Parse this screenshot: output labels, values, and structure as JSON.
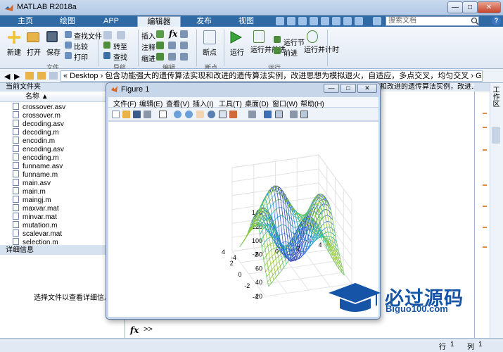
{
  "app": {
    "title": "MATLAB R2018a",
    "min_label": "—",
    "max_label": "□",
    "close_label": "✕"
  },
  "tabs": [
    {
      "label": "主页"
    },
    {
      "label": "绘图"
    },
    {
      "label": "APP"
    },
    {
      "label": "编辑器"
    },
    {
      "label": "发布"
    },
    {
      "label": "视图"
    }
  ],
  "search": {
    "placeholder": "搜索文档",
    "help_label": "?"
  },
  "ribbon": {
    "file": {
      "new": "新建",
      "open": "打开",
      "save": "保存",
      "find_files": "查找文件",
      "compare": "比较",
      "print": "打印",
      "group": "文件"
    },
    "navigate": {
      "goto": "转至",
      "find": "查找",
      "group": "导航"
    },
    "edit": {
      "insert": "插入",
      "comment": "注释",
      "indent": "缩进",
      "fx": "fx",
      "group": "编辑"
    },
    "breakpoints": {
      "label": "断点",
      "group": "断点"
    },
    "run": {
      "run": "运行",
      "run_advance": "运行并前进",
      "run_section": "运行节",
      "advance": "前进",
      "run_time": "运行并计时",
      "group": "运行"
    }
  },
  "address": {
    "path": "« Desktop › 包含功能强大的遗传算法实现和改进的遗传算法实例，改进思想为模拟退火，自适应，多点交叉，均匀交叉 › GAandtheimprove › ga"
  },
  "current_folder": {
    "title": "当前文件夹",
    "name_col": "名称 ▲",
    "files": [
      "crossover.asv",
      "crossover.m",
      "decoding.asv",
      "decoding.m",
      "encodin.m",
      "encoding.asv",
      "encoding.m",
      "funname.asv",
      "funname.m",
      "main.asv",
      "main.m",
      "maingj.m",
      "maxvar.mat",
      "minvar.mat",
      "mutation.m",
      "scalevar.mat",
      "selection.m"
    ]
  },
  "details": {
    "title": "详细信息",
    "text": "选择文件以查看详细信息"
  },
  "workspace": {
    "title": "工作区"
  },
  "editor": {
    "header": "和改进的遗传算法实例，改进..."
  },
  "command": {
    "fx": "fx",
    "prompt": ">>"
  },
  "status": {
    "line_label": "行",
    "line": "1",
    "col_label": "列",
    "col": "1"
  },
  "figure": {
    "title": "Figure 1",
    "menu": [
      "文件(F)",
      "编辑(E)",
      "查看(V)",
      "插入(I)",
      "工具(T)",
      "桌面(D)",
      "窗口(W)",
      "帮助(H)"
    ],
    "toolbar_icons": [
      "new-icon",
      "open-icon",
      "save-icon",
      "print-icon",
      "pointer-icon",
      "zoom-in-icon",
      "zoom-out-icon",
      "pan-icon",
      "rotate-icon",
      "datacursor-icon",
      "brush-icon",
      "link-icon",
      "colorbar-icon",
      "legend-icon",
      "hide-tools-icon",
      "show-tools-icon"
    ]
  },
  "chart_data": {
    "type": "surface",
    "title": "",
    "xlabel": "",
    "ylabel": "",
    "zlabel": "",
    "x_range": [
      -4,
      4
    ],
    "y_range": [
      -4,
      4
    ],
    "zlim": [
      20,
      140
    ],
    "x_ticks": [
      "-4",
      "-2",
      "0",
      "2",
      "4"
    ],
    "y_ticks": [
      "-4",
      "-2",
      "0",
      "2",
      "4"
    ],
    "z_ticks": [
      "20",
      "40",
      "60",
      "80",
      "100",
      "120",
      "140"
    ],
    "grid": true,
    "colormap": "parula",
    "mesh_style": "mesh",
    "z_min_approx": 20,
    "z_max_approx": 135
  },
  "watermark": {
    "line1": "必过源码",
    "line2": "Biguo100.com"
  },
  "colors": {
    "tab_bg": "#2f6aa5",
    "accent": "#1554a6"
  }
}
